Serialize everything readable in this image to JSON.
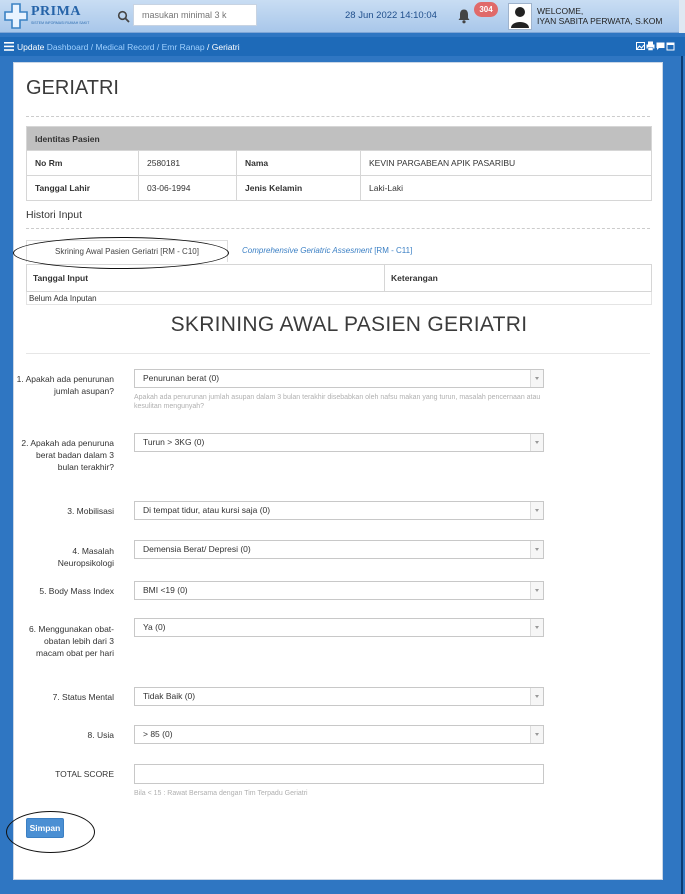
{
  "header": {
    "logo_text": "PRIMA",
    "logo_subtitle": "SISTEM INFORMASI RUMAH SAKIT",
    "search_placeholder": "masukan minimal 3 k",
    "datetime": "28 Jun 2022 14:10:04",
    "notification_count": "304",
    "welcome_label": "WELCOME,",
    "user_name": "IYAN SABITA PERWATA, S.KOM"
  },
  "breadcrumb": {
    "prefix": "Update",
    "items": [
      "Dashboard",
      "Medical Record",
      "Emr Ranap"
    ],
    "separator": " / ",
    "current": "Geriatri"
  },
  "page": {
    "title": "GERIATRI"
  },
  "identitas": {
    "header": "Identitas Pasien",
    "no_rm_label": "No Rm",
    "no_rm_value": "2580181",
    "nama_label": "Nama",
    "nama_value": "KEVIN PARGABEAN APIK PASARIBU",
    "tgl_lahir_label": "Tanggal Lahir",
    "tgl_lahir_value": "03-06-1994",
    "jk_label": "Jenis Kelamin",
    "jk_value": "Laki-Laki"
  },
  "histori": {
    "title": "Histori Input",
    "tabs": [
      {
        "label": "Skrining Awal Pasien Geriatri [RM - C10]",
        "active": true
      },
      {
        "label_italic": "Comprehensive Geriatric Assesment",
        "label_code": " [RM - C11]",
        "active": false
      }
    ],
    "columns": [
      "Tanggal Input",
      "Keterangan"
    ],
    "empty_text": "Belum Ada Inputan"
  },
  "form": {
    "title": "SKRINING AWAL PASIEN GERIATRI",
    "questions": [
      {
        "label": "1. Apakah ada penurunan jumlah asupan?",
        "value": "Penurunan berat (0)",
        "help": "Apakah ada penurunan jumlah asupan dalam 3 bulan terakhir disebabkan oleh nafsu makan yang turun, masalah pencernaan atau kesulitan mengunyah?"
      },
      {
        "label": "2. Apakah ada penuruna berat badan dalam 3 bulan terakhir?",
        "value": "Turun > 3KG (0)"
      },
      {
        "label": "3. Mobilisasi",
        "value": "Di tempat tidur, atau kursi saja (0)"
      },
      {
        "label": "4. Masalah Neuropsikologi",
        "value": "Demensia Berat/ Depresi (0)"
      },
      {
        "label": "5. Body Mass Index",
        "value": "BMI <19 (0)"
      },
      {
        "label": "6. Menggunakan obat-obatan lebih dari 3 macam obat per hari",
        "value": "Ya (0)"
      },
      {
        "label": "7. Status Mental",
        "value": "Tidak Baik (0)"
      },
      {
        "label": "8. Usia",
        "value": "> 85 (0)"
      }
    ],
    "total_label": "TOTAL SCORE",
    "total_value": "",
    "total_help": "Bila < 15 : Rawat Bersama dengan Tim Terpadu Geriatri",
    "save_label": "Simpan"
  },
  "colors": {
    "background": "#2f76c2",
    "navbar": "#1e6ab8",
    "button": "#4a8fd3",
    "badge": "#e06a6a"
  }
}
